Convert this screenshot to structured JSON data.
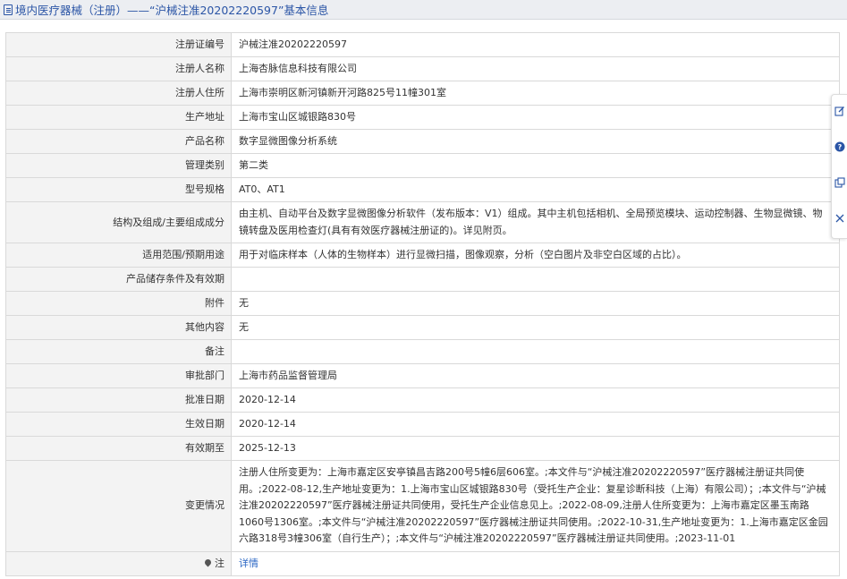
{
  "header": {
    "title": "境内医疗器械（注册）——“沪械注准20202220597”基本信息"
  },
  "rows": [
    {
      "label": "注册证编号",
      "value": "沪械注准20202220597"
    },
    {
      "label": "注册人名称",
      "value": "上海杏脉信息科技有限公司"
    },
    {
      "label": "注册人住所",
      "value": "上海市崇明区新河镇新开河路825号11幢301室"
    },
    {
      "label": "生产地址",
      "value": "上海市宝山区城银路830号"
    },
    {
      "label": "产品名称",
      "value": "数字显微图像分析系统"
    },
    {
      "label": "管理类别",
      "value": "第二类"
    },
    {
      "label": "型号规格",
      "value": "AT0、AT1"
    },
    {
      "label": "结构及组成/主要组成成分",
      "value": "由主机、自动平台及数字显微图像分析软件（发布版本：V1）组成。其中主机包括相机、全局预览模块、运动控制器、生物显微镜、物镜转盘及医用检查灯(具有有效医疗器械注册证的)。详见附页。"
    },
    {
      "label": "适用范围/预期用途",
      "value": "用于对临床样本（人体的生物样本）进行显微扫描，图像观察，分析（空白图片及非空白区域的占比）。"
    },
    {
      "label": "产品储存条件及有效期",
      "value": ""
    },
    {
      "label": "附件",
      "value": "无"
    },
    {
      "label": "其他内容",
      "value": "无"
    },
    {
      "label": "备注",
      "value": ""
    },
    {
      "label": "审批部门",
      "value": "上海市药品监督管理局"
    },
    {
      "label": "批准日期",
      "value": "2020-12-14"
    },
    {
      "label": "生效日期",
      "value": "2020-12-14"
    },
    {
      "label": "有效期至",
      "value": "2025-12-13"
    },
    {
      "label": "变更情况",
      "value": "注册人住所变更为：上海市嘉定区安亭镇昌吉路200号5幢6层606室。;本文件与“沪械注准20202220597”医疗器械注册证共同使用。;2022-08-12,生产地址变更为：1.上海市宝山区城银路830号（受托生产企业：复星诊断科技（上海）有限公司）；;本文件与“沪械注准20202220597”医疗器械注册证共同使用，受托生产企业信息见上。;2022-08-09,注册人住所变更为：上海市嘉定区墨玉南路1060号1306室。;本文件与“沪械注准20202220597”医疗器械注册证共同使用。;2022-10-31,生产地址变更为：1.上海市嘉定区金园六路318号3幢306室（自行生产）；;本文件与“沪械注准20202220597”医疗器械注册证共同使用。;2023-11-01"
    }
  ],
  "note_row": {
    "label": "注",
    "link": "详情"
  },
  "side_toolbar": {
    "icons": [
      "edit-icon",
      "help-icon",
      "share-icon",
      "close-icon"
    ]
  },
  "colors": {
    "accent": "#2b55a6",
    "link": "#2b67c4",
    "label_bg": "#f3f3f3",
    "border": "#d9d9d9"
  }
}
